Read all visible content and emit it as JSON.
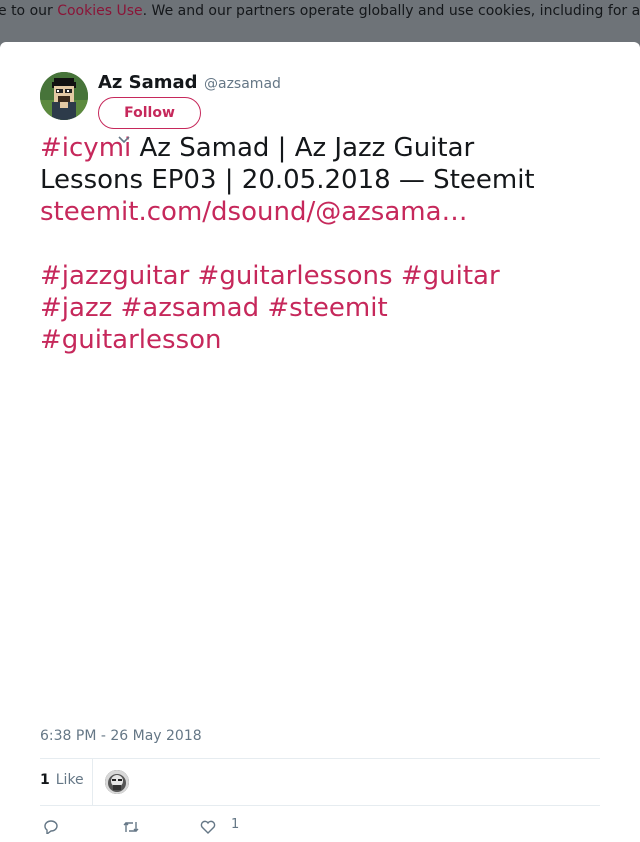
{
  "cookie_banner": {
    "text_before": "e to our ",
    "link_label": "Cookies Use",
    "text_after": ". We and our partners operate globally and use cookies, including for a"
  },
  "tweet": {
    "author": {
      "display_name": "Az Samad",
      "handle": "@azsamad"
    },
    "follow_label": "Follow",
    "text": {
      "hashtag_icymi": "#icymi",
      "title_line1": " Az Samad | Az Jazz Guitar",
      "title_line2": "Lessons EP03 | 20.05.2018 — Steemit",
      "link": "steemit.com/dsound/@azsama…",
      "hashtags_line1": [
        "#jazzguitar",
        "#guitarlessons",
        "#guitar"
      ],
      "hashtags_line2": [
        "#jazz",
        "#azsamad",
        "#steemit"
      ],
      "hashtags_line3": [
        "#guitarlesson"
      ]
    },
    "timestamp": "6:38 PM - 26 May 2018",
    "stats": {
      "likes_count": "1",
      "likes_label": "Like"
    },
    "actions": {
      "reply_icon": "reply-icon",
      "retweet_icon": "retweet-icon",
      "like_icon": "heart-icon",
      "like_count": "1"
    }
  },
  "colors": {
    "accent": "#c6285b",
    "cookie_link": "#8a1538",
    "text_primary": "#14171a",
    "text_secondary": "#657786",
    "overlay": "#6e7378"
  }
}
